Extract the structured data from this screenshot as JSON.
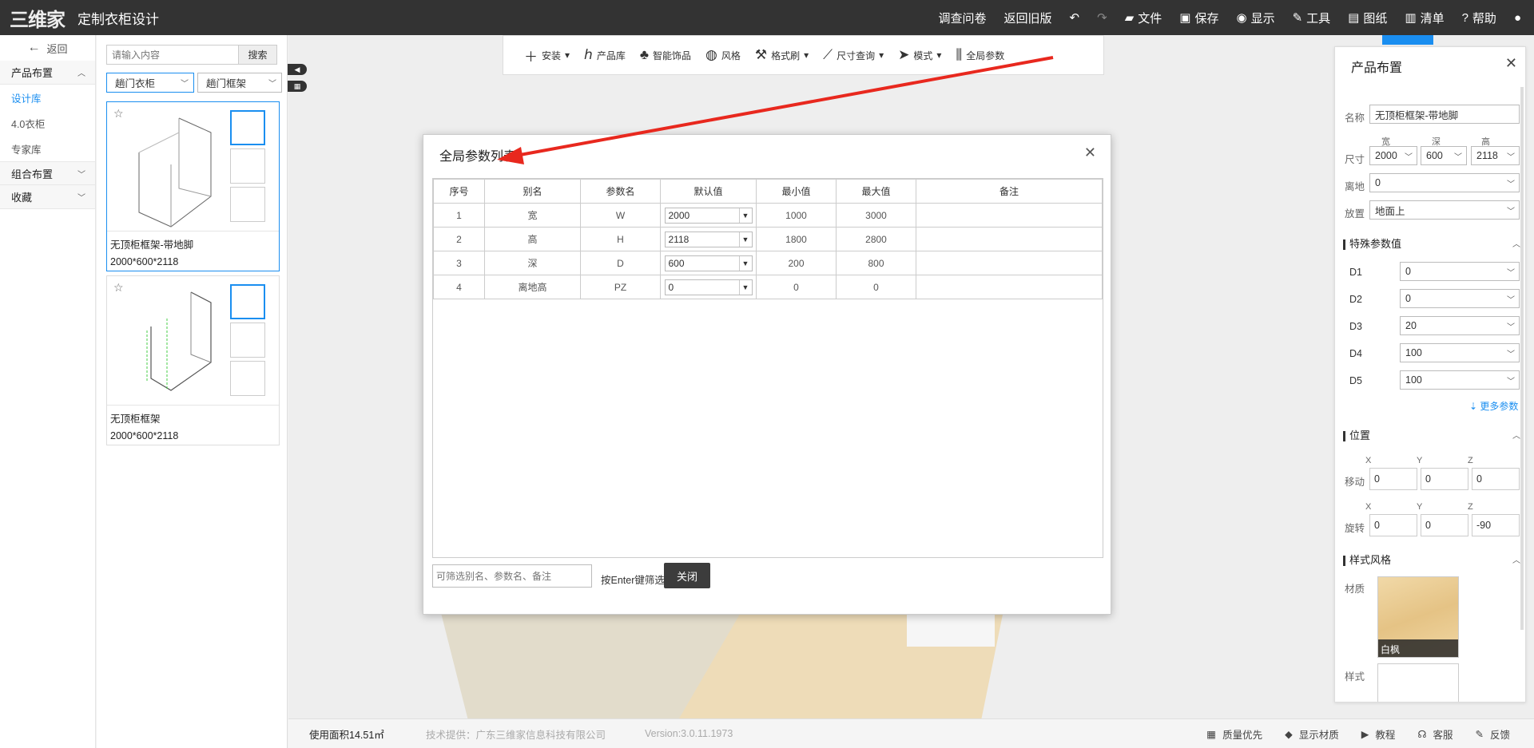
{
  "header": {
    "logo_text": "三维家",
    "app_title": "定制衣柜设计",
    "nav": [
      {
        "label": "调查问卷",
        "icon": ""
      },
      {
        "label": "返回旧版",
        "icon": ""
      },
      {
        "label": "",
        "icon": "undo-icon"
      },
      {
        "label": "",
        "icon": "redo-icon"
      },
      {
        "label": "文件",
        "icon": "folder-icon"
      },
      {
        "label": "保存",
        "icon": "save-icon"
      },
      {
        "label": "显示",
        "icon": "eye-icon"
      },
      {
        "label": "工具",
        "icon": "wrench-icon"
      },
      {
        "label": "图纸",
        "icon": "map-icon"
      },
      {
        "label": "清单",
        "icon": "list-icon"
      },
      {
        "label": "帮助",
        "icon": "help-icon"
      },
      {
        "label": "",
        "icon": "user-icon"
      }
    ]
  },
  "leftnav": {
    "back_label": "返回",
    "sections": [
      {
        "label": "产品布置",
        "subs": [
          "设计库",
          "4.0衣柜",
          "专家库"
        ],
        "active_sub": "设计库"
      },
      {
        "label": "组合布置"
      },
      {
        "label": "收藏"
      }
    ]
  },
  "library": {
    "search_placeholder": "请输入内容",
    "search_button": "搜索",
    "filter1": "趟门衣柜",
    "filter2": "趟门框架",
    "items": [
      {
        "name": "无顶柜框架-带地脚",
        "dims": "2000*600*2118"
      },
      {
        "name": "无顶柜框架",
        "dims": "2000*600*2118"
      }
    ]
  },
  "toolbar": {
    "items": [
      {
        "label": "安装",
        "icon": "plus-icon",
        "dropdown": true
      },
      {
        "label": "产品库",
        "icon": "chair-icon",
        "dropdown": false
      },
      {
        "label": "智能饰品",
        "icon": "plant-icon",
        "dropdown": false
      },
      {
        "label": "风格",
        "icon": "palette-icon",
        "dropdown": false
      },
      {
        "label": "格式刷",
        "icon": "brush-icon",
        "dropdown": true
      },
      {
        "label": "尺寸查询",
        "icon": "ruler-icon",
        "dropdown": true
      },
      {
        "label": "模式",
        "icon": "cursor-icon",
        "dropdown": true
      },
      {
        "label": "全局参数",
        "icon": "sliders-icon",
        "dropdown": false
      }
    ]
  },
  "dialog": {
    "title": "全局参数列表",
    "columns": [
      "序号",
      "别名",
      "参数名",
      "默认值",
      "最小值",
      "最大值",
      "备注"
    ],
    "rows": [
      {
        "idx": "1",
        "alias": "宽",
        "name": "W",
        "default": "2000",
        "min": "1000",
        "max": "3000",
        "note": ""
      },
      {
        "idx": "2",
        "alias": "高",
        "name": "H",
        "default": "2118",
        "min": "1800",
        "max": "2800",
        "note": ""
      },
      {
        "idx": "3",
        "alias": "深",
        "name": "D",
        "default": "600",
        "min": "200",
        "max": "800",
        "note": ""
      },
      {
        "idx": "4",
        "alias": "离地高",
        "name": "PZ",
        "default": "0",
        "min": "0",
        "max": "0",
        "note": ""
      }
    ],
    "filter_placeholder": "可筛选别名、参数名、备注",
    "filter_hint": "按Enter键筛选",
    "close_label": "关闭"
  },
  "panel": {
    "title": "产品布置",
    "name_label": "名称",
    "name_value": "无顶柜框架-带地脚",
    "size_label": "尺寸",
    "size_headers": [
      "宽",
      "深",
      "高"
    ],
    "size_values": [
      "2000",
      "600",
      "2118"
    ],
    "ground_label": "离地",
    "ground_value": "0",
    "place_label": "放置",
    "place_value": "地面上",
    "special_title": "特殊参数值",
    "special": [
      {
        "label": "D1",
        "value": "0"
      },
      {
        "label": "D2",
        "value": "0"
      },
      {
        "label": "D3",
        "value": "20"
      },
      {
        "label": "D4",
        "value": "100"
      },
      {
        "label": "D5",
        "value": "100"
      }
    ],
    "more_params": "更多参数",
    "position_title": "位置",
    "xyz": [
      "X",
      "Y",
      "Z"
    ],
    "move_label": "移动",
    "move_values": [
      "0",
      "0",
      "0"
    ],
    "rotate_label": "旋转",
    "rotate_values": [
      "0",
      "0",
      "-90"
    ],
    "style_title": "样式风格",
    "material_label": "材质",
    "material_name": "白枫",
    "style_label": "样式"
  },
  "status": {
    "area": "使用面积14.51㎡",
    "provider": "技术提供：广东三维家信息科技有限公司",
    "version": "Version:3.0.11.1973",
    "right": [
      {
        "label": "质量优先",
        "icon": "quality-icon"
      },
      {
        "label": "显示材质",
        "icon": "cube-icon"
      },
      {
        "label": "教程",
        "icon": "play-icon"
      },
      {
        "label": "客服",
        "icon": "headset-icon"
      },
      {
        "label": "反馈",
        "icon": "edit-icon"
      }
    ]
  },
  "colors": {
    "accent": "#1a8ef0",
    "topbar": "#333333",
    "arrow": "#e8281e"
  }
}
